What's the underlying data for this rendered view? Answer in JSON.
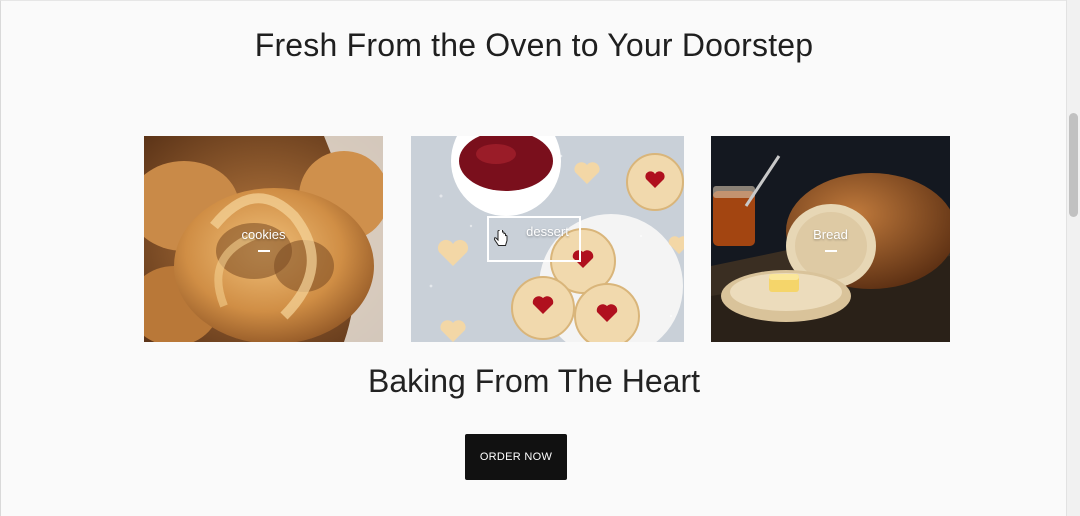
{
  "main": {
    "headline": "Fresh From the Oven to Your Doorstep",
    "subheadline": "Baking From The Heart",
    "order_button_label": "ORDER NOW"
  },
  "categories": [
    {
      "label": "cookies",
      "image": "pretzel-pastry"
    },
    {
      "label": "dessert",
      "image": "heart-jam-cookies"
    },
    {
      "label": "Bread",
      "image": "sliced-bread-loaf"
    }
  ],
  "colors": {
    "button_bg": "#111111",
    "page_bg": "#fafafa"
  }
}
